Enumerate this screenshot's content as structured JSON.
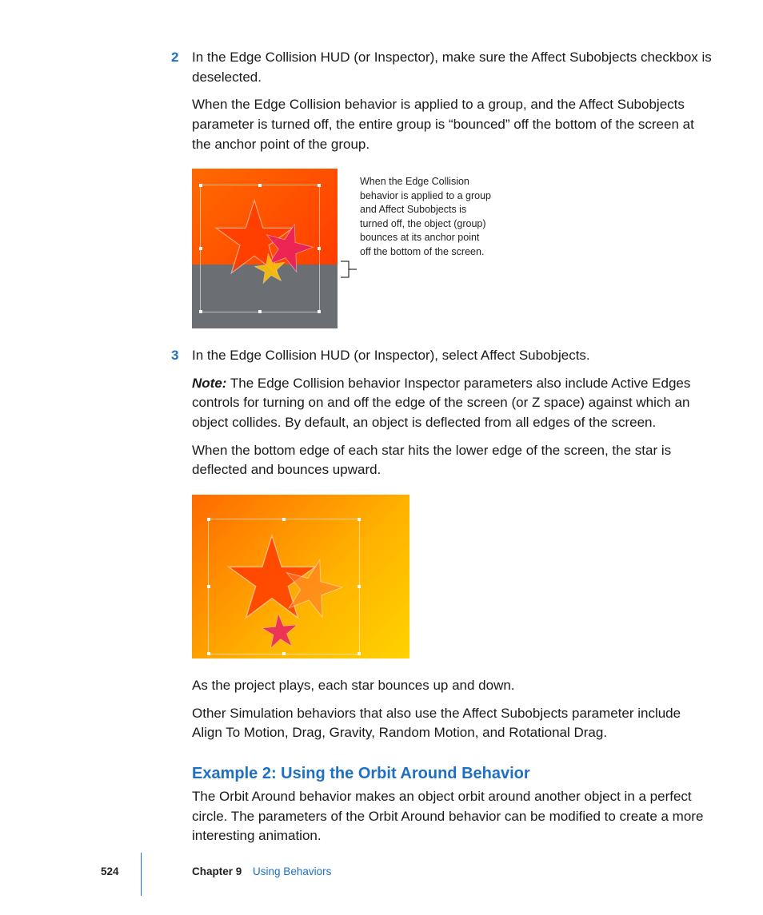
{
  "steps": {
    "s2": {
      "num": "2",
      "p1": "In the Edge Collision HUD (or Inspector), make sure the Affect Subobjects checkbox is deselected.",
      "p2": "When the Edge Collision behavior is applied to a group, and the Affect Subobjects parameter is turned off, the entire group is “bounced” off the bottom of the screen at the anchor point of the group."
    },
    "s3": {
      "num": "3",
      "p1": "In the Edge Collision HUD (or Inspector), select Affect Subobjects.",
      "noteLabel": "Note:",
      "noteBody": "  The Edge Collision behavior Inspector parameters also include Active Edges controls for turning on and off the edge of the screen (or Z space) against which an object collides. By default, an object is deflected from all edges of the screen.",
      "p2": "When the bottom edge of each star hits the lower edge of the screen, the star is deflected and bounces upward."
    }
  },
  "fig1": {
    "caption": "When the Edge Collision behavior is applied to a group and Affect Subobjects is turned off, the object (group) bounces at its anchor point off the bottom of the screen."
  },
  "after": {
    "p1": "As the project plays, each star bounces up and down.",
    "p2": "Other Simulation behaviors that also use the Affect Subobjects parameter include Align To Motion, Drag, Gravity, Random Motion, and Rotational Drag."
  },
  "heading2": "Example 2: Using the Orbit Around Behavior",
  "h2p1": "The Orbit Around behavior makes an object orbit around another object in a perfect circle. The parameters of the Orbit Around behavior can be modified to create a more interesting animation.",
  "footer": {
    "page": "524",
    "chapter": "Chapter 9",
    "title": "Using Behaviors"
  }
}
